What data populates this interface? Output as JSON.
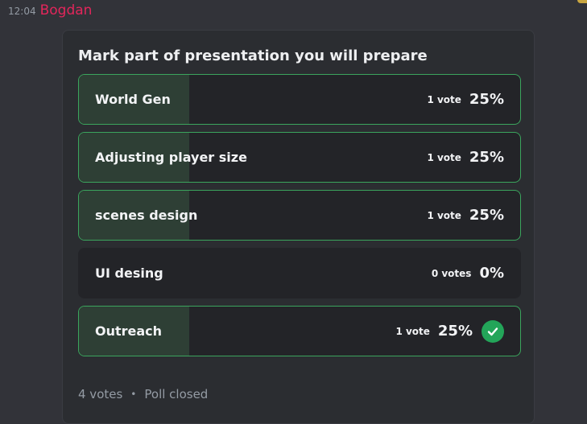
{
  "message": {
    "timestamp": "12:04",
    "author": "Bogdan"
  },
  "poll": {
    "question": "Mark part of presentation you will prepare",
    "answers": [
      {
        "label": "World Gen",
        "votes": "1 vote",
        "percent": "25%",
        "fraction": 0.25,
        "selected": false
      },
      {
        "label": "Adjusting player size",
        "votes": "1 vote",
        "percent": "25%",
        "fraction": 0.25,
        "selected": false
      },
      {
        "label": "scenes design",
        "votes": "1 vote",
        "percent": "25%",
        "fraction": 0.25,
        "selected": false
      },
      {
        "label": "UI desing",
        "votes": "0 votes",
        "percent": "0%",
        "fraction": 0,
        "selected": false
      },
      {
        "label": "Outreach",
        "votes": "1 vote",
        "percent": "25%",
        "fraction": 0.25,
        "selected": true
      }
    ],
    "total_votes": "4 votes",
    "separator": "•",
    "status": "Poll closed"
  },
  "colors": {
    "author": "#e2265b",
    "fill": "#2e3f35",
    "border": "#3ba55d",
    "check": "#23a559"
  },
  "icons": {
    "selected": "check-icon"
  }
}
